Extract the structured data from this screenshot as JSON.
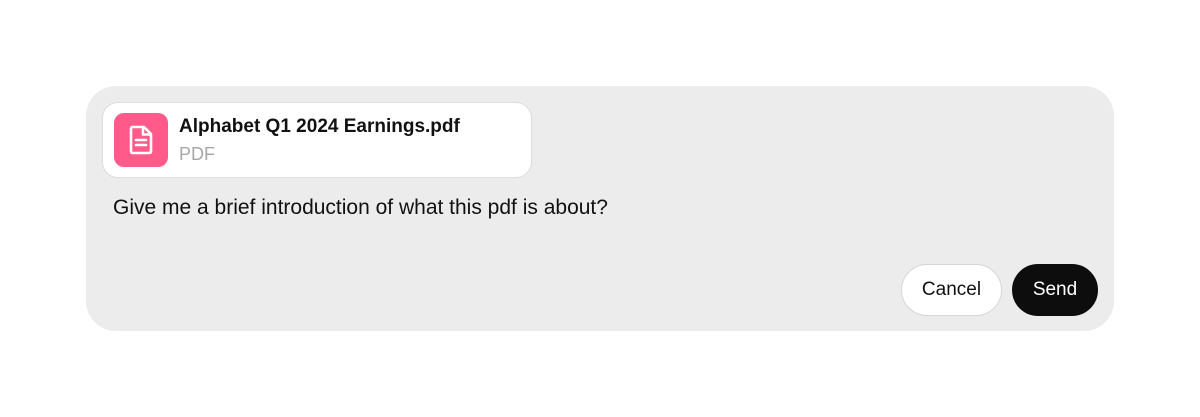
{
  "attachment": {
    "file_name": "Alphabet Q1 2024 Earnings.pdf",
    "file_type": "PDF",
    "icon": "document-icon",
    "icon_color": "#ff5a8a"
  },
  "message": {
    "text": "Give me a brief introduction of what this pdf is about?"
  },
  "actions": {
    "cancel_label": "Cancel",
    "send_label": "Send"
  },
  "colors": {
    "composer_background": "#ececec",
    "send_background": "#0d0d0d"
  }
}
